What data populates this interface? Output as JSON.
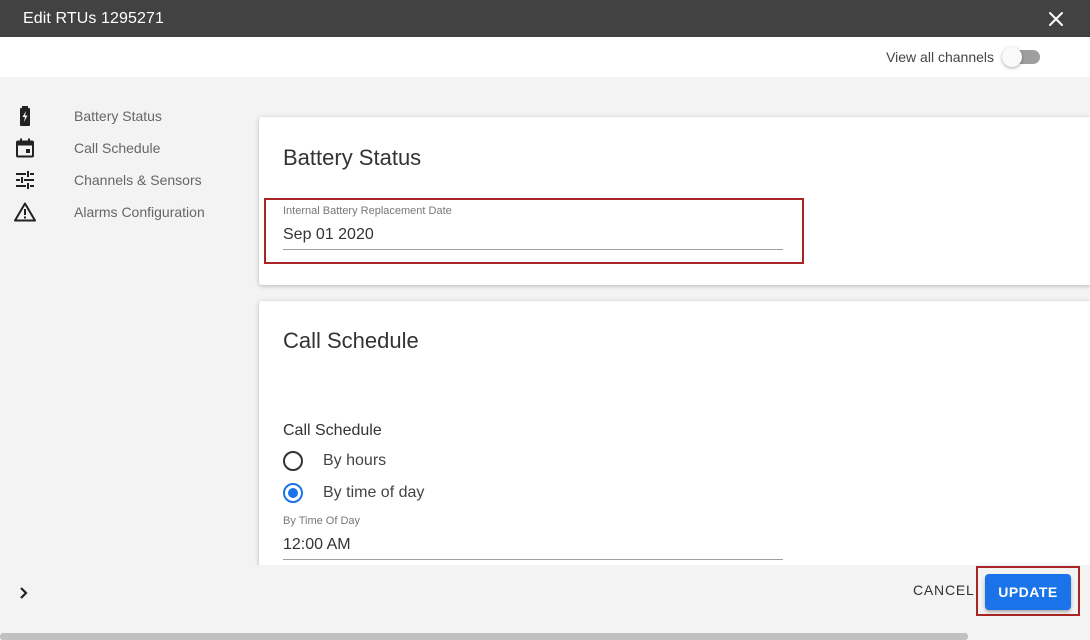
{
  "window": {
    "title": "Edit RTUs 1295271",
    "close_icon": "close-icon"
  },
  "topbar": {
    "view_all_label": "View all channels",
    "view_all_on": false
  },
  "sidebar": {
    "items": [
      {
        "label": "Battery Status",
        "icon": "battery-icon"
      },
      {
        "label": "Call Schedule",
        "icon": "calendar-icon"
      },
      {
        "label": "Channels & Sensors",
        "icon": "sliders-icon"
      },
      {
        "label": "Alarms Configuration",
        "icon": "warning-icon"
      }
    ]
  },
  "battery": {
    "title": "Battery Status",
    "field_label": "Internal Battery Replacement Date",
    "field_value": "Sep 01 2020"
  },
  "call": {
    "title": "Call Schedule",
    "section_label": "Call Schedule",
    "options": [
      {
        "label": "By hours",
        "checked": false
      },
      {
        "label": "By time of day",
        "checked": true
      }
    ],
    "field_label": "By Time Of Day",
    "field_value": "12:00 AM"
  },
  "footer": {
    "cancel_label": "CANCEL",
    "update_label": "UPDATE"
  },
  "colors": {
    "accent": "#1a73e8",
    "titlebar": "#424242",
    "highlight": "#a82525"
  }
}
